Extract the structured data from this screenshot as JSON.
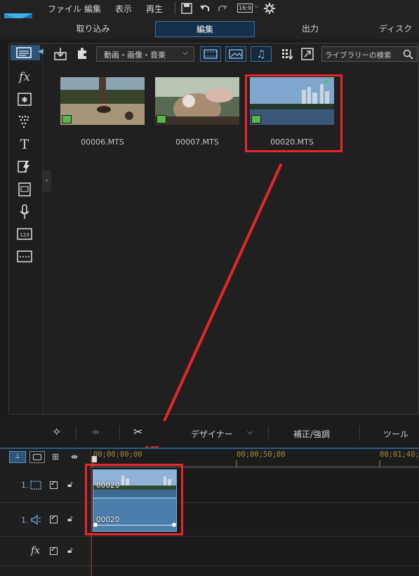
{
  "menu": {
    "items": [
      "ファイル",
      "編集",
      "表示",
      "再生"
    ],
    "aspect": "16:9"
  },
  "tabs": {
    "import": "取り込み",
    "edit": "編集",
    "output": "出力",
    "disc": "ディスク"
  },
  "library": {
    "filter": "動画・画像・音楽",
    "search_placeholder": "ライブラリーの検索",
    "clips": [
      {
        "name": "00006.MTS",
        "selected": false
      },
      {
        "name": "00007.MTS",
        "selected": false
      },
      {
        "name": "00020.MTS",
        "selected": true
      }
    ]
  },
  "lower_toolbar": {
    "designer": "デザイナー",
    "correct": "補正/強調",
    "tools": "ツール"
  },
  "timeline": {
    "timecodes": [
      "00;00;00;00",
      "00;00;50;00",
      "00;01;40;"
    ],
    "tracks": [
      {
        "number": "1.",
        "kind": "video"
      },
      {
        "number": "1.",
        "kind": "audio"
      },
      {
        "number": "",
        "kind": "fx"
      }
    ],
    "clip_label": "00020"
  },
  "colors": {
    "accent": "#2b5478",
    "highlight": "#e8262a",
    "timecode": "#a98a45"
  },
  "icons": [
    "logo-icon",
    "save-icon",
    "undo-icon",
    "redo-icon",
    "gear-icon",
    "import-icon",
    "plugin-icon",
    "search-icon",
    "scissors-icon",
    "magic-icon",
    "split-icon"
  ]
}
